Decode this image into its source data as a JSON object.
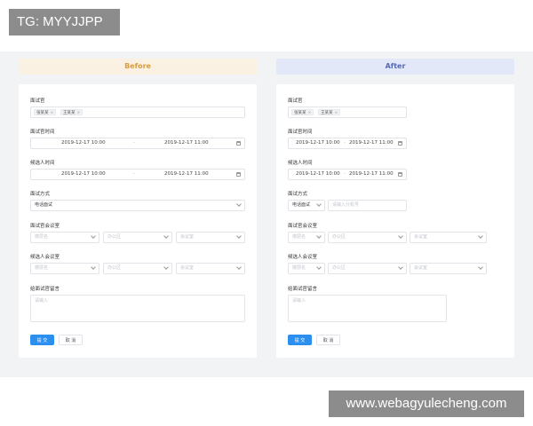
{
  "overlay": {
    "tg_label": "TG: MYYJJPP",
    "watermark": "www.webagyulecheng.com"
  },
  "fields": {
    "interviewer": "面试官",
    "interviewer_time": "面试官时间",
    "candidate_time": "候选人时间",
    "interview_method": "面试方式",
    "interviewer_room": "面试官会议室",
    "candidate_room": "候选人会议室",
    "message": "给面试官留言"
  },
  "tags": [
    "张某某",
    "王某某"
  ],
  "dates": {
    "start": "2019-12-17 10:00",
    "end": "2019-12-17 11:00",
    "separator": "-"
  },
  "method_value": "电话面试",
  "placeholders": {
    "building": "楼层名",
    "office": "办公区",
    "room": "会议室",
    "textarea": "请输入",
    "phone": "请输入分机号"
  },
  "buttons": {
    "submit": "提 交",
    "cancel": "取 消"
  },
  "before": {
    "title": "Before"
  },
  "after": {
    "title": "After"
  },
  "colors": {
    "before_header_bg": "#fbf1e2",
    "before_header_text": "#d89d3c",
    "after_header_bg": "#e3e8f8",
    "after_header_text": "#5468b8",
    "primary": "#2b8ff0"
  }
}
